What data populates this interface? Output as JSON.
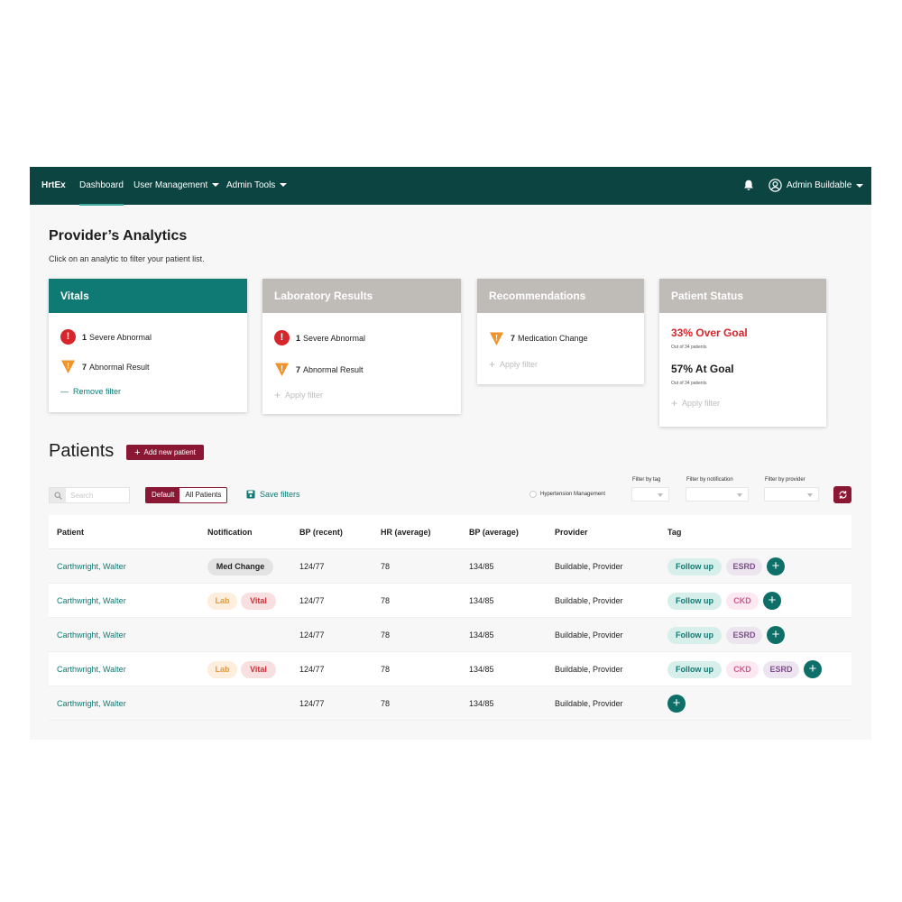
{
  "nav": {
    "brand": "HrtEx",
    "links": [
      {
        "label": "Dashboard"
      },
      {
        "label": "User Management"
      },
      {
        "label": "Admin Tools"
      }
    ],
    "user_name": "Admin Buildable"
  },
  "analytics": {
    "title": "Provider’s Analytics",
    "subtitle": "Click on an analytic to filter your patient list.",
    "cards": [
      {
        "title": "Vitals",
        "items": [
          {
            "count": "1",
            "label": "Severe Abnormal",
            "icon": "error-icon"
          },
          {
            "count": "7",
            "label": "Abnormal Result",
            "icon": "warning-icon"
          }
        ],
        "action": "Remove filter"
      },
      {
        "title": "Laboratory Results",
        "items": [
          {
            "count": "1",
            "label": "Severe Abnormal",
            "icon": "error-icon"
          },
          {
            "count": "7",
            "label": "Abnormal Result",
            "icon": "warning-icon"
          }
        ],
        "action": "Apply filter"
      },
      {
        "title": "Recommendations",
        "items": [
          {
            "count": "7",
            "label": "Medication Change",
            "icon": "warning-icon"
          }
        ],
        "action": "Apply filter"
      },
      {
        "title": "Patient Status",
        "stats": [
          {
            "value": "33% Over Goal",
            "sub": "Out of 34 patients"
          },
          {
            "value": "57% At Goal",
            "sub": "Out of 34 patients"
          }
        ],
        "action": "Apply filter"
      }
    ]
  },
  "patients": {
    "title": "Patients",
    "add_label": "Add new patient",
    "search_placeholder": "Search",
    "segment": [
      "Default",
      "All Patients"
    ],
    "save_filters": "Save filters",
    "hypertension_label": "Hypertension Management",
    "filters": {
      "tag_label": "Filter by tag",
      "notification_label": "Filter by notification",
      "provider_label": "Filter by provider"
    },
    "columns": [
      "Patient",
      "Notification",
      "BP (recent)",
      "HR (average)",
      "BP (average)",
      "Provider",
      "Tag"
    ],
    "rows": [
      {
        "patient": "Carthwright, Walter",
        "notifications": [
          "Med Change"
        ],
        "bp_recent": "124/77",
        "hr_avg": "78",
        "bp_avg": "134/85",
        "provider": "Buildable, Provider",
        "tags": [
          "Follow up",
          "ESRD"
        ]
      },
      {
        "patient": "Carthwright, Walter",
        "notifications": [
          "Lab",
          "Vital"
        ],
        "bp_recent": "124/77",
        "hr_avg": "78",
        "bp_avg": "134/85",
        "provider": "Buildable, Provider",
        "tags": [
          "Follow up",
          "CKD"
        ]
      },
      {
        "patient": "Carthwright, Walter",
        "notifications": [],
        "bp_recent": "124/77",
        "hr_avg": "78",
        "bp_avg": "134/85",
        "provider": "Buildable, Provider",
        "tags": [
          "Follow up",
          "ESRD"
        ]
      },
      {
        "patient": "Carthwright, Walter",
        "notifications": [
          "Lab",
          "Vital"
        ],
        "bp_recent": "124/77",
        "hr_avg": "78",
        "bp_avg": "134/85",
        "provider": "Buildable, Provider",
        "tags": [
          "Follow up",
          "CKD",
          "ESRD"
        ]
      },
      {
        "patient": "Carthwright, Walter",
        "notifications": [],
        "bp_recent": "124/77",
        "hr_avg": "78",
        "bp_avg": "134/85",
        "provider": "Buildable, Provider",
        "tags": []
      }
    ]
  },
  "colors": {
    "nav_bg": "#0b4440",
    "teal": "#0e7a73",
    "maroon": "#8a1834",
    "alert_red": "#d7262b",
    "warning_orange": "#f0932b"
  }
}
